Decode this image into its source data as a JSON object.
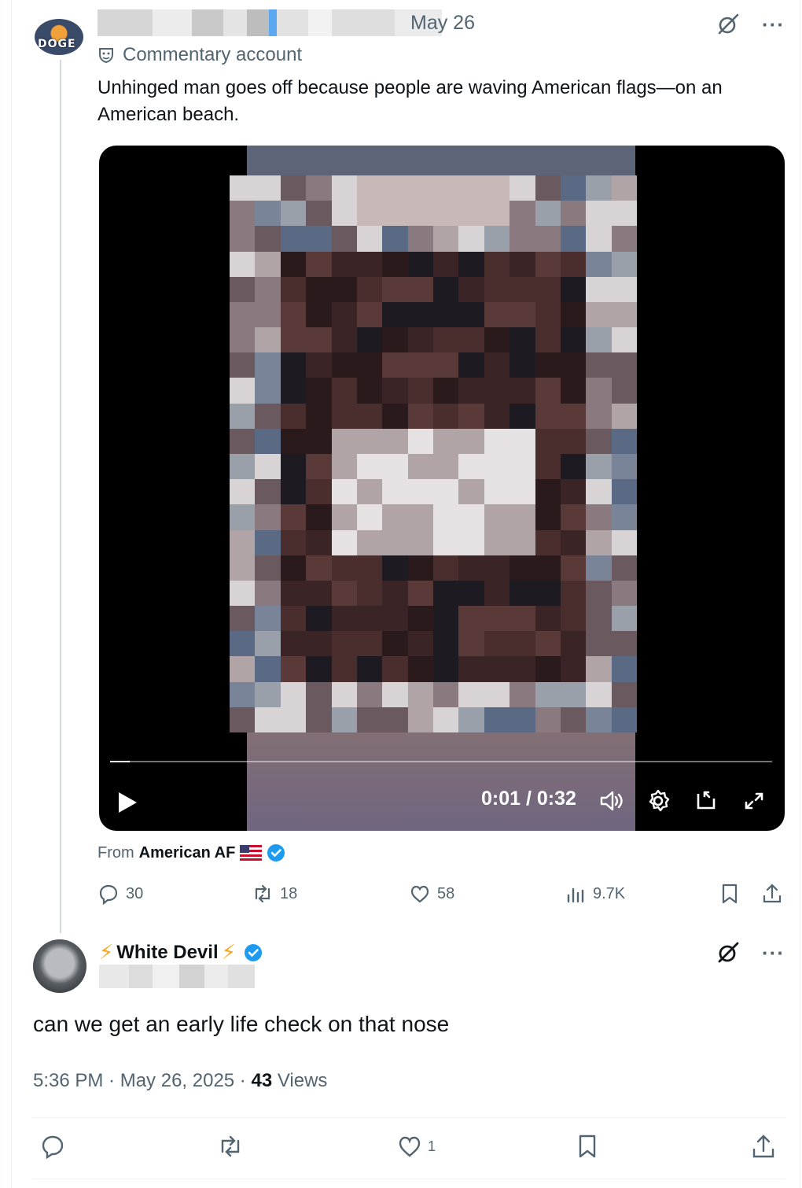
{
  "parent": {
    "date": "May 26",
    "label": "Commentary account",
    "text": "Unhinged man goes off because people are waving American flags—on an American beach.",
    "video": {
      "time": "0:01 / 0:32",
      "progress": 0.03
    },
    "from_prefix": "From",
    "from_source": "American AF",
    "stats": {
      "replies": "30",
      "reposts": "18",
      "likes": "58",
      "views": "9.7K"
    },
    "avatar_text": "DOGE"
  },
  "reply": {
    "name": "White Devil",
    "text": "can we get an early life check on that nose",
    "time": "5:36 PM · May 26, 2025 · ",
    "views_count": "43",
    "views_label": " Views",
    "likes": "1"
  },
  "colors": {
    "verified": "#1d9bf0",
    "muted": "#536471",
    "bolt": "#f5a623"
  }
}
